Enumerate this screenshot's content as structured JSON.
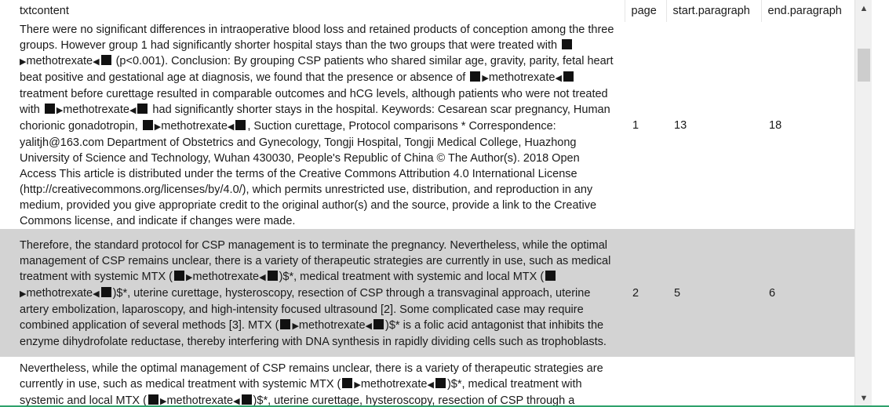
{
  "table": {
    "columns": [
      "txtcontent",
      "page",
      "start.paragraph",
      "end.paragraph"
    ],
    "rows": [
      {
        "segments": [
          "There were no significant differences in intraoperative blood loss and retained products of conception among the three groups. However group 1 had significantly shorter hospital stays than the two groups that were treated with ",
          "methotrexate",
          " (p<0.001). Conclusion: By grouping CSP patients who shared similar age, gravity, parity, fetal heart beat positive and gestational age at diagnosis, we found that the presence or absence of ",
          "methotrexate",
          " treatment before curettage resulted in comparable outcomes and hCG levels, although patients who were not treated with ",
          "methotrexate",
          " had significantly shorter stays in the hospital. Keywords: Cesarean scar pregnancy, Human chorionic gonadotropin, ",
          "methotrexate",
          ", Suction curettage, Protocol comparisons  * Correspondence: yalitjh@163.com Department of Obstetrics and Gynecology, Tongji Hospital, Tongji Medical College, Huazhong University of Science and Technology, Wuhan 430030, People's Republic of China © The Author(s). 2018 Open Access This article is distributed under the terms of the Creative Commons Attribution 4.0 International License (http://creativecommons.org/licenses/by/4.0/), which permits unrestricted use, distribution, and reproduction in any medium, provided you give appropriate credit to the original author(s) and the source, provide a link to the Creative Commons license, and indicate if changes were made."
        ],
        "page": "1",
        "start": "13",
        "end": "18"
      },
      {
        "segments": [
          "Therefore, the standard protocol for CSP management is to terminate the pregnancy. Nevertheless, while the optimal management of CSP remains unclear, there is a variety of therapeutic strategies are currently in use, such as medical treatment with systemic MTX (",
          "methotrexate",
          ")$*, medical treatment with systemic and local MTX (",
          "methotrexate",
          ")$*, uterine curettage, hysteroscopy, resection of CSP through a transvaginal approach, uterine artery embolization, laparoscopy, and high-intensity focused ultrasound [2]. Some complicated case may require combined application of several methods [3]. MTX (",
          "methotrexate",
          ")$* is a folic acid antagonist that inhibits the enzyme dihydrofolate reductase, thereby interfering with DNA synthesis in rapidly dividing cells such as trophoblasts."
        ],
        "page": "2",
        "start": "5",
        "end": "6"
      },
      {
        "segments": [
          "Nevertheless, while the optimal management of CSP remains unclear, there is a variety of therapeutic strategies are currently in use, such as medical treatment with systemic MTX (",
          "methotrexate",
          ")$*, medical treatment with systemic and local MTX (",
          "methotrexate",
          ")$*, uterine curettage, hysteroscopy, resection of CSP through a"
        ],
        "page": "",
        "start": "",
        "end": ""
      }
    ]
  },
  "scrollbar": {
    "up_icon": "chevron-up-icon",
    "down_icon": "chevron-down-icon"
  },
  "colors": {
    "alt_row": "#d3d3d3",
    "accent_line": "#2ea16b"
  }
}
